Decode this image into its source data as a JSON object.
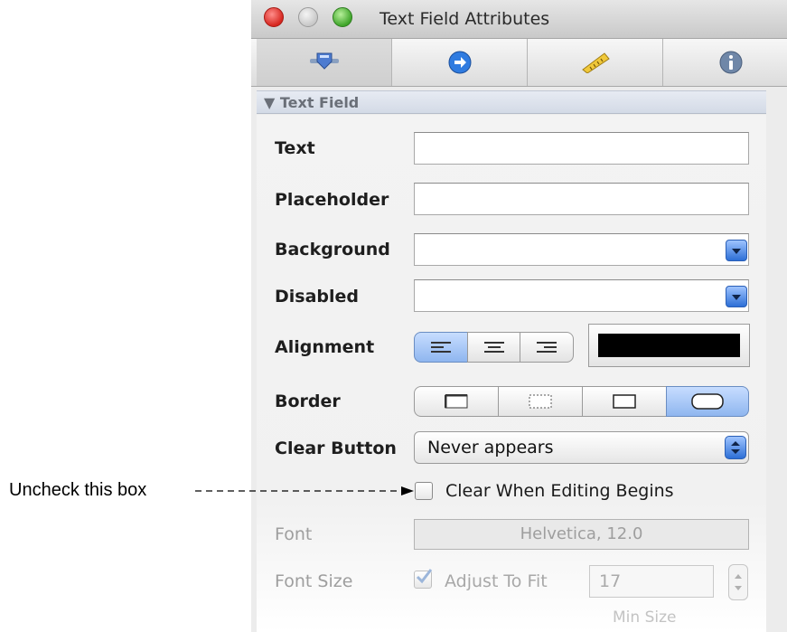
{
  "window": {
    "title": "Text Field Attributes"
  },
  "toolbar": {
    "tabs": [
      {
        "name": "attributes",
        "icon": "slider-knob-icon"
      },
      {
        "name": "connections",
        "icon": "arrow-right-circle-icon"
      },
      {
        "name": "size",
        "icon": "ruler-icon"
      },
      {
        "name": "identity",
        "icon": "info-icon"
      }
    ]
  },
  "section": {
    "title": "▼ Text Field"
  },
  "fields": {
    "text": {
      "label": "Text",
      "value": ""
    },
    "placeholder": {
      "label": "Placeholder",
      "value": ""
    },
    "background": {
      "label": "Background",
      "value": ""
    },
    "disabled": {
      "label": "Disabled",
      "value": ""
    },
    "alignment": {
      "label": "Alignment",
      "options": [
        "left",
        "center",
        "right"
      ],
      "selected": "left"
    },
    "text_color": "#000000",
    "border": {
      "label": "Border",
      "options": [
        "line",
        "bezel",
        "square",
        "rounded"
      ],
      "selected": "rounded"
    },
    "clear_button": {
      "label": "Clear Button",
      "value": "Never appears"
    },
    "clear_when_editing": {
      "label": "Clear When Editing Begins",
      "checked": false
    },
    "font": {
      "label": "Font",
      "value": "Helvetica, 12.0"
    },
    "font_size": {
      "label": "Font Size",
      "adjust_label": "Adjust To Fit",
      "adjust_checked": true,
      "min_value": "17",
      "min_label": "Min Size"
    }
  },
  "annotation": {
    "text": "Uncheck this box"
  },
  "colors": {
    "accent": "#3b7ddd",
    "window_bg": "#ececec",
    "section_header": "#d7dde8"
  }
}
